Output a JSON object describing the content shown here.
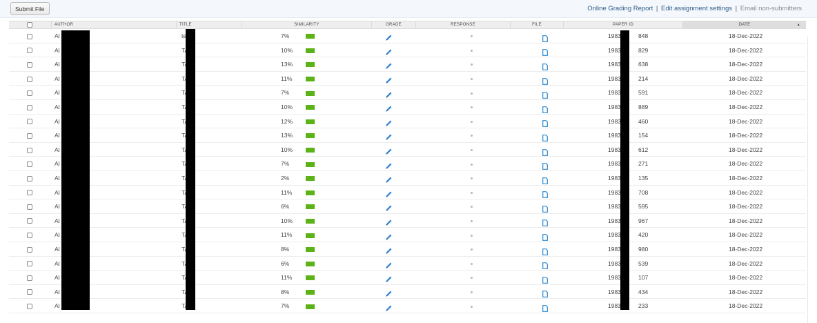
{
  "toolbar": {
    "submit_label": "Submit File",
    "links": {
      "grading_report": "Online Grading Report",
      "separator": "|",
      "edit_settings": "Edit assignment settings",
      "email_nonsubmitters": "Email non-submitters"
    }
  },
  "table": {
    "columns": {
      "author": "AUTHOR",
      "title": "TITLE",
      "similarity": "SIMILARITY",
      "grade": "GRADE",
      "response": "RESPONSE",
      "file": "FILE",
      "paper_id": "PAPER ID",
      "date": "DATE",
      "sort_indicator": "▲"
    },
    "rows": [
      {
        "author": "Al",
        "title": "te",
        "similarity": "7%",
        "paper_id_prefix": "1983",
        "paper_id_suffix": "848",
        "date": "18-Dec-2022"
      },
      {
        "author": "Al",
        "title": "TA",
        "similarity": "10%",
        "paper_id_prefix": "1983",
        "paper_id_suffix": "829",
        "date": "18-Dec-2022"
      },
      {
        "author": "Al",
        "title": "TA",
        "similarity": "13%",
        "paper_id_prefix": "1983",
        "paper_id_suffix": "638",
        "date": "18-Dec-2022"
      },
      {
        "author": "Al",
        "title": "TA",
        "similarity": "11%",
        "paper_id_prefix": "1983",
        "paper_id_suffix": "214",
        "date": "18-Dec-2022"
      },
      {
        "author": "Al",
        "title": "TA",
        "similarity": "7%",
        "paper_id_prefix": "1983",
        "paper_id_suffix": "591",
        "date": "18-Dec-2022"
      },
      {
        "author": "Al",
        "title": "TA",
        "similarity": "10%",
        "paper_id_prefix": "1983",
        "paper_id_suffix": "889",
        "date": "18-Dec-2022"
      },
      {
        "author": "Al",
        "title": "TA",
        "similarity": "12%",
        "paper_id_prefix": "1983",
        "paper_id_suffix": "460",
        "date": "18-Dec-2022"
      },
      {
        "author": "Al",
        "title": "TA",
        "similarity": "13%",
        "paper_id_prefix": "1983",
        "paper_id_suffix": "154",
        "date": "18-Dec-2022"
      },
      {
        "author": "Al",
        "title": "TA",
        "similarity": "10%",
        "paper_id_prefix": "1983",
        "paper_id_suffix": "612",
        "date": "18-Dec-2022"
      },
      {
        "author": "Al",
        "title": "TA",
        "similarity": "7%",
        "paper_id_prefix": "1983",
        "paper_id_suffix": "271",
        "date": "18-Dec-2022"
      },
      {
        "author": "Al",
        "title": "TA",
        "similarity": "2%",
        "paper_id_prefix": "1983",
        "paper_id_suffix": "135",
        "date": "18-Dec-2022"
      },
      {
        "author": "Al",
        "title": "TA",
        "similarity": "11%",
        "paper_id_prefix": "1983",
        "paper_id_suffix": "708",
        "date": "18-Dec-2022"
      },
      {
        "author": "Al",
        "title": "TA",
        "similarity": "6%",
        "paper_id_prefix": "1983",
        "paper_id_suffix": "595",
        "date": "18-Dec-2022"
      },
      {
        "author": "Al",
        "title": "TA",
        "similarity": "10%",
        "paper_id_prefix": "1983",
        "paper_id_suffix": "967",
        "date": "18-Dec-2022"
      },
      {
        "author": "Al",
        "title": "TA",
        "similarity": "11%",
        "paper_id_prefix": "1983",
        "paper_id_suffix": "420",
        "date": "18-Dec-2022"
      },
      {
        "author": "Al",
        "title": "TA",
        "similarity": "8%",
        "paper_id_prefix": "1983",
        "paper_id_suffix": "980",
        "date": "18-Dec-2022"
      },
      {
        "author": "Al",
        "title": "TA",
        "similarity": "6%",
        "paper_id_prefix": "1983",
        "paper_id_suffix": "539",
        "date": "18-Dec-2022"
      },
      {
        "author": "Al",
        "title": "TA",
        "similarity": "11%",
        "paper_id_prefix": "1983",
        "paper_id_suffix": "107",
        "date": "18-Dec-2022"
      },
      {
        "author": "Al",
        "title": "TA",
        "similarity": "8%",
        "paper_id_prefix": "1983",
        "paper_id_suffix": "434",
        "date": "18-Dec-2022"
      },
      {
        "author": "Al",
        "title": "TA",
        "similarity": "7%",
        "paper_id_prefix": "1983",
        "paper_id_suffix": "233",
        "date": "18-Dec-2022"
      }
    ]
  },
  "icons": {
    "grade": "pencil-icon",
    "response": "dot-icon",
    "file": "document-icon"
  },
  "colors": {
    "similarity_bar": "#5bb318",
    "grade_pencil": "#2b7fd6",
    "file_icon": "#2b89d1",
    "link": "#2c5a8a",
    "redaction": "#000000"
  }
}
